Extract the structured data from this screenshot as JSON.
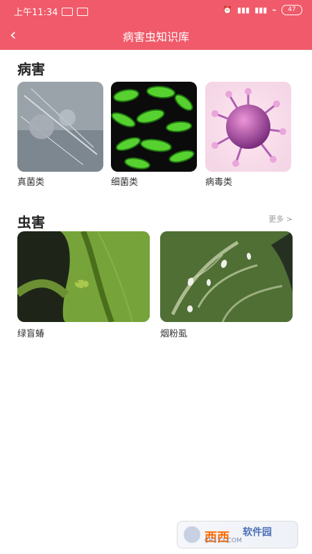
{
  "status_bar": {
    "time": "上午11:34",
    "battery": "47"
  },
  "header": {
    "title": "病害虫知识库"
  },
  "sections": [
    {
      "title": "病害",
      "items": [
        {
          "label": "真菌类"
        },
        {
          "label": "细菌类"
        },
        {
          "label": "病毒类"
        }
      ]
    },
    {
      "title": "虫害",
      "more": "更多 >",
      "items": [
        {
          "label": "绿盲蝽"
        },
        {
          "label": "烟粉虱"
        }
      ]
    }
  ],
  "watermark": {
    "left": "西西",
    "right": "软件园",
    "sub": "CR173.COM"
  }
}
